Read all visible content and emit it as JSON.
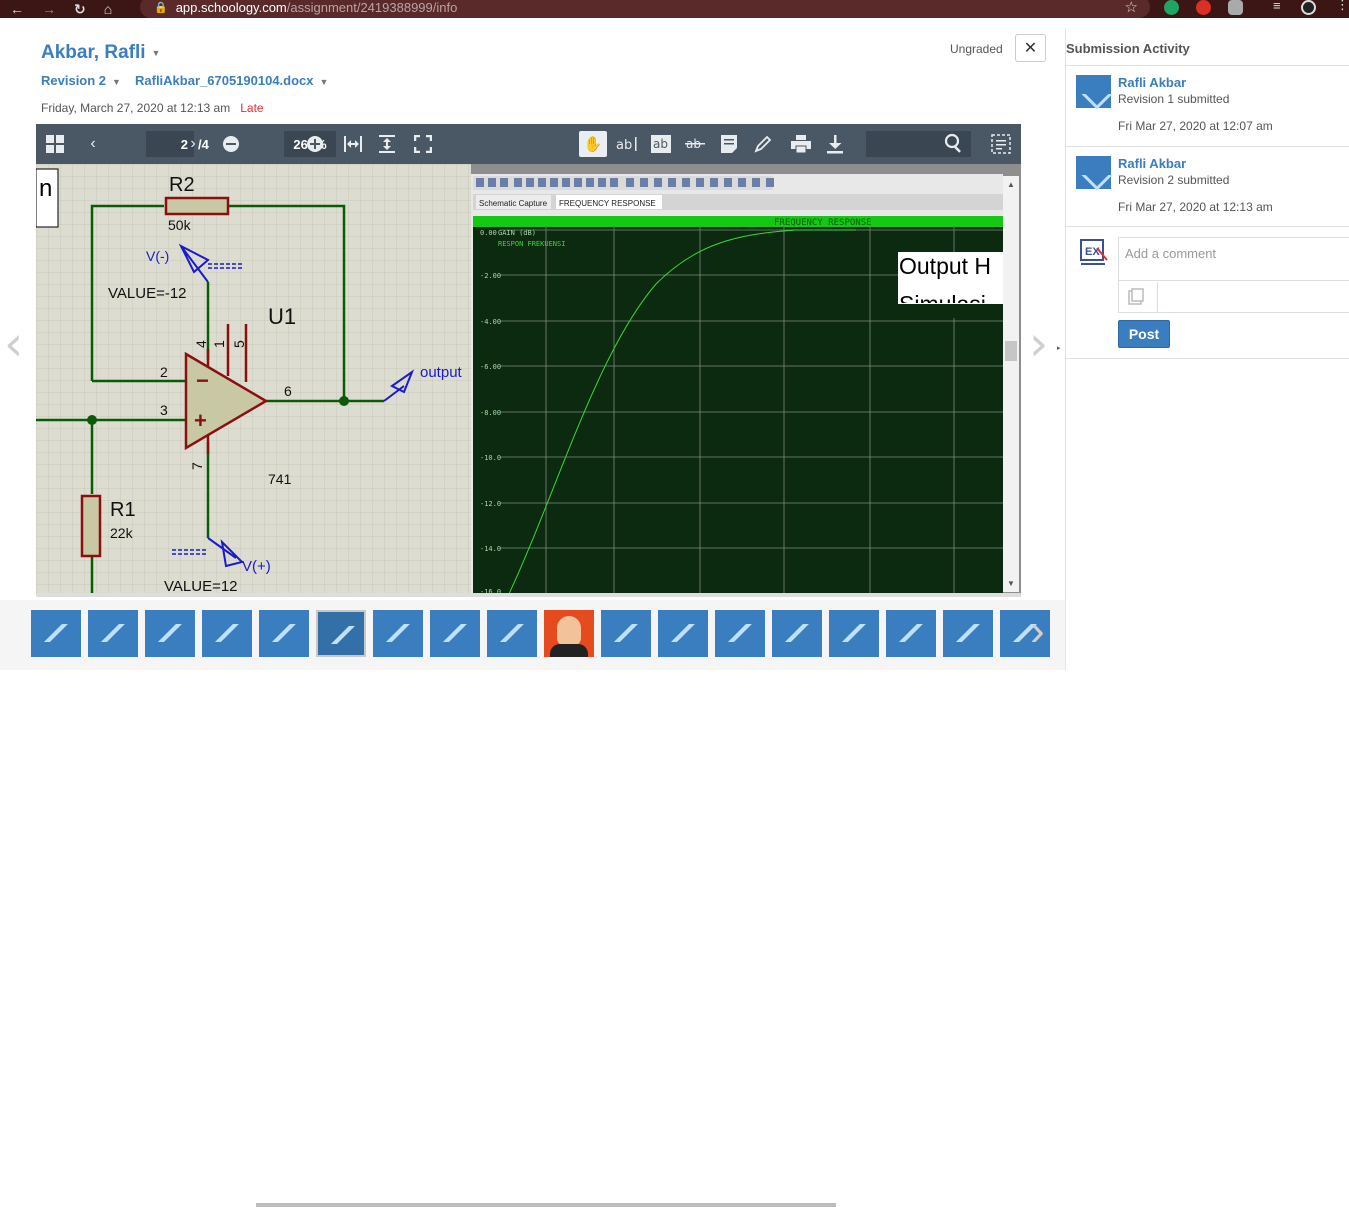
{
  "browser": {
    "url_host": "app.schoology.com",
    "url_path": "/assignment/2419388999/info",
    "star_icon": "star-icon"
  },
  "submission": {
    "student_name": "Akbar, Rafli",
    "revision_label": "Revision 2",
    "file_name": "RafliAkbar_6705190104.docx",
    "date_text": "Friday, March 27, 2020 at 12:13 am",
    "late_label": "Late",
    "grade_status": "Ungraded",
    "close_label": "✕"
  },
  "viewer": {
    "current_page": "2",
    "total_pages": "/4",
    "zoom": "262%"
  },
  "document": {
    "schematic": {
      "corner_text": "n",
      "r2_label": "R2",
      "r2_value": "50k",
      "vminus_label": "V(-)",
      "vminus_value": "VALUE=-12",
      "u1_label": "U1",
      "pin4": "4",
      "pin1": "1",
      "pin5": "5",
      "pin2": "2",
      "pin3": "3",
      "pin6": "6",
      "pin7": "7",
      "output_label": "output",
      "opamp_model": "741",
      "r1_label": "R1",
      "r1_value": "22k",
      "vplus_label": "V(+)",
      "vplus_value": "VALUE=12"
    },
    "graph": {
      "tab1": "Schematic Capture",
      "tab2": "FREQUENCY RESPONSE",
      "title": "FREQUENCY RESPONSE",
      "gain_label": "GAIN (dB)",
      "legend": "RESPON FREKUENSI",
      "y_ticks": [
        "0.00",
        "-2.00",
        "-4.00",
        "-6.00",
        "-8.00",
        "-10.0",
        "-12.0",
        "-14.0",
        "-16.0"
      ],
      "overlay_line1": "Output H",
      "overlay_line2": "Simulasi"
    }
  },
  "panel": {
    "title": "Submission Activity",
    "activities": [
      {
        "name": "Rafli Akbar",
        "text": "Revision 1 submitted",
        "time": "Fri Mar 27, 2020 at 12:07 am"
      },
      {
        "name": "Rafli Akbar",
        "text": "Revision 2 submitted",
        "time": "Fri Mar 27, 2020 at 12:13 am"
      }
    ],
    "comment_placeholder": "Add a comment",
    "post_label": "Post"
  },
  "thumbnails": {
    "count": 18,
    "active_index": 5,
    "photo_index": 9
  },
  "colors": {
    "accent": "#3a7ebf",
    "late": "#e2312f",
    "toolbar": "#4a5866",
    "schematic_bg": "#dcdcd0",
    "wire": "#0a5a0a",
    "graph_bg": "#0c2a10",
    "graph_curve": "#38d838"
  }
}
